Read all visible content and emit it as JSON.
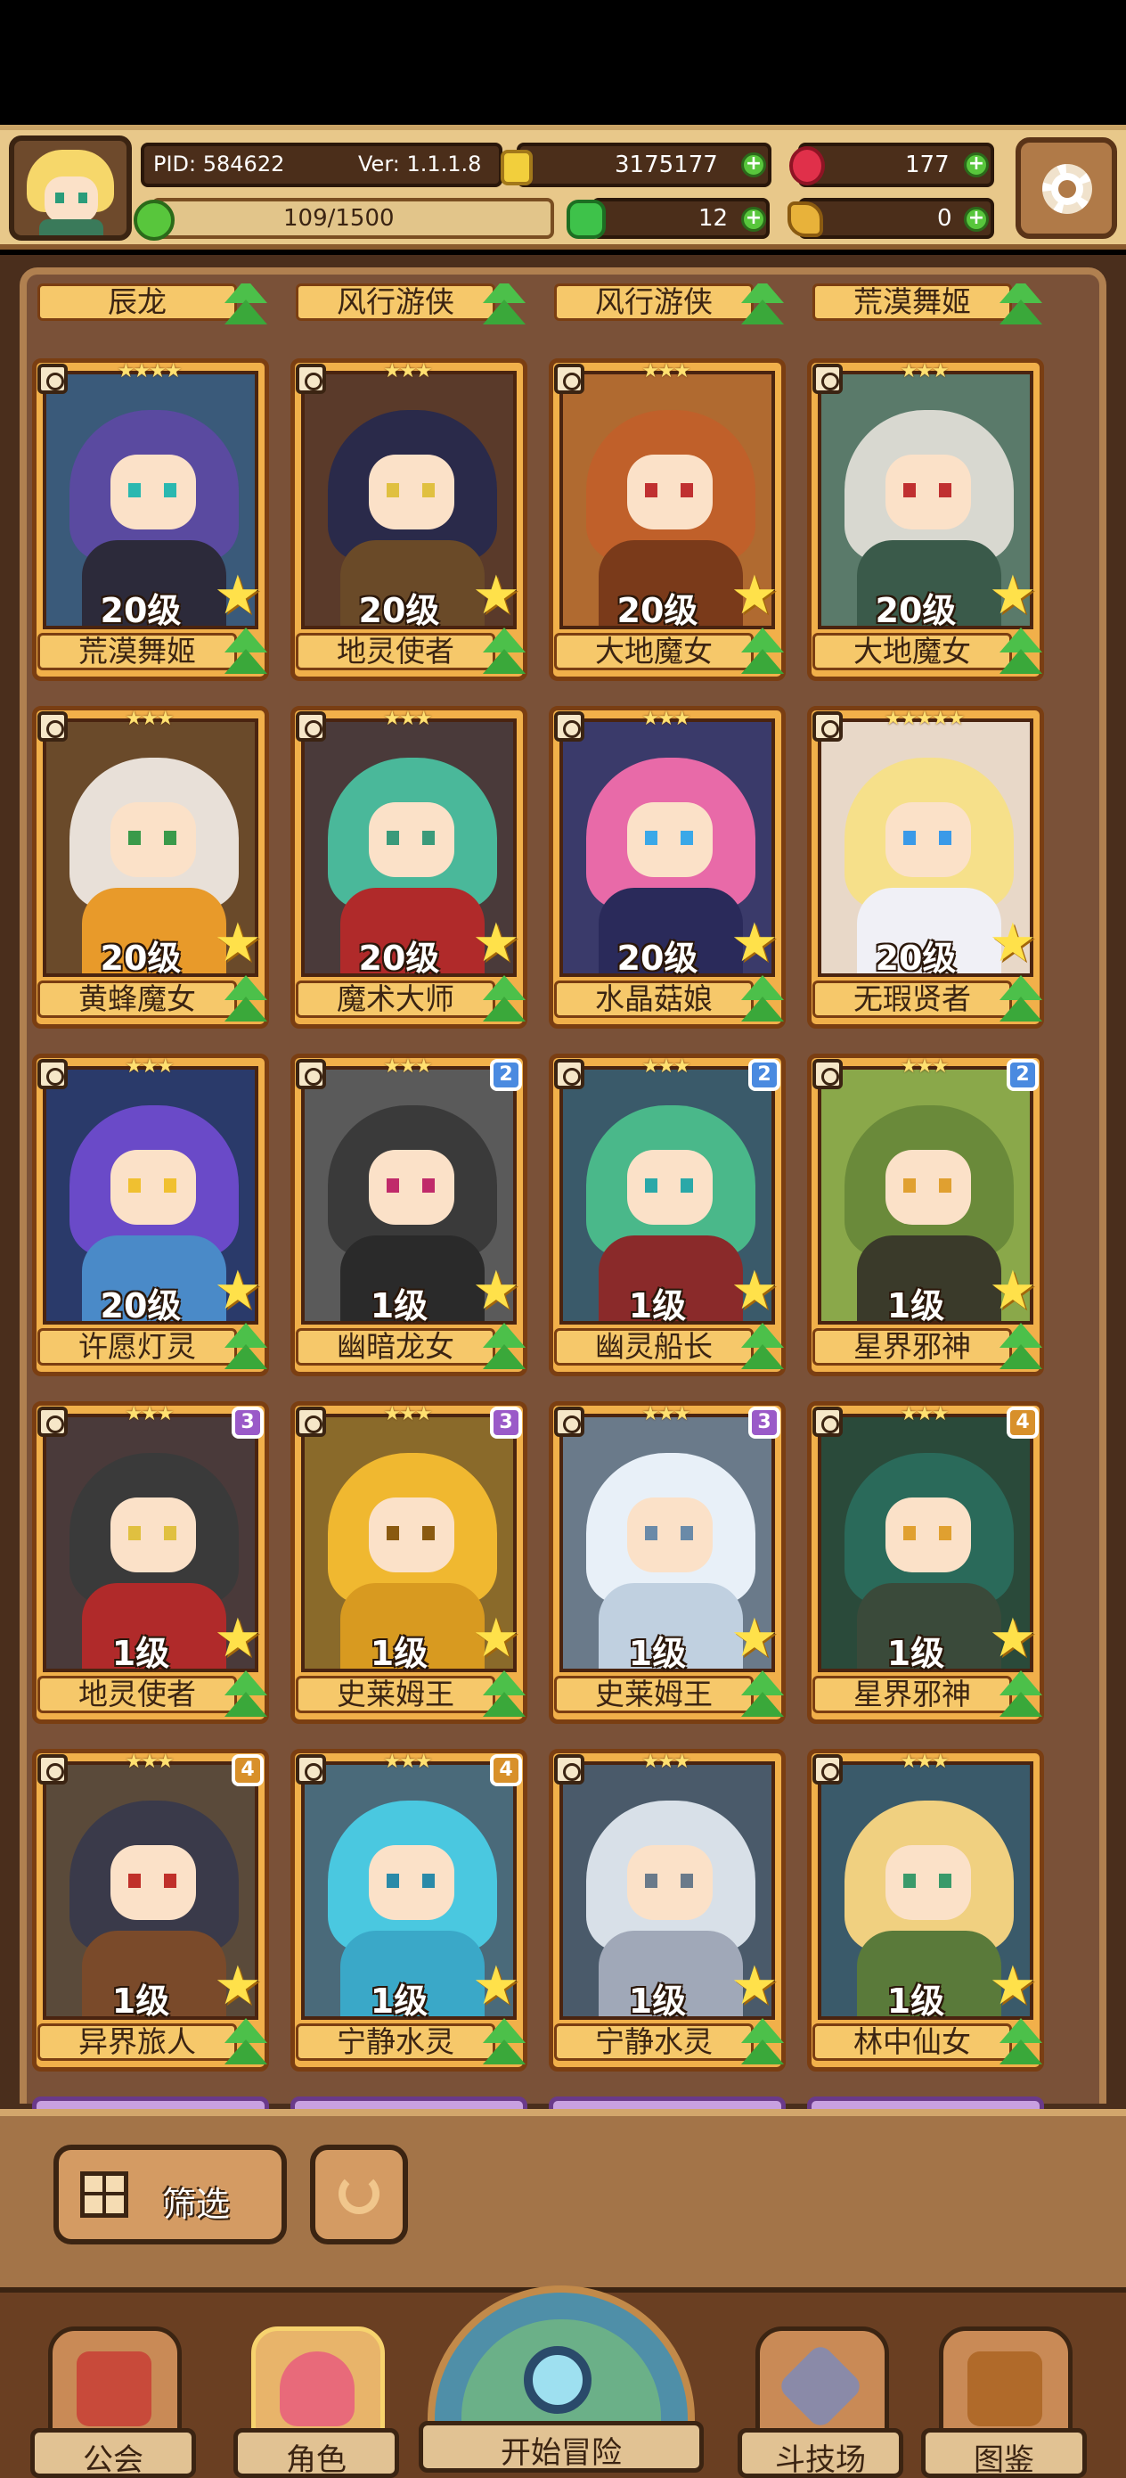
{
  "header": {
    "pid": "PID: 584622",
    "version": "Ver: 1.1.1.8",
    "gold": "3175177",
    "gems": "177",
    "exp": "109/1500",
    "clover": "12",
    "keys": "0"
  },
  "top_row_names": [
    "辰龙",
    "风行游侠",
    "风行游侠",
    "荒漠舞姬"
  ],
  "cards": [
    {
      "name": "荒漠舞姬",
      "level": "20级",
      "stars": "★★★★",
      "badge": "",
      "hair": "#5a4aa0",
      "body": "#2c2a3a",
      "bg": "#3a5a7a",
      "eye": "#2ab8b0"
    },
    {
      "name": "地灵使者",
      "level": "20级",
      "stars": "★★★",
      "badge": "",
      "hair": "#2a2a4a",
      "body": "#6a4a28",
      "bg": "#5a3a2a",
      "eye": "#e0c040"
    },
    {
      "name": "大地魔女",
      "level": "20级",
      "stars": "★★★",
      "badge": "",
      "hair": "#c0602a",
      "body": "#7a3a1a",
      "bg": "#b06a30",
      "eye": "#c03030"
    },
    {
      "name": "大地魔女",
      "level": "20级",
      "stars": "★★★",
      "badge": "",
      "hair": "#d8d8d0",
      "body": "#3a5a4a",
      "bg": "#5a7a6a",
      "eye": "#c03030"
    },
    {
      "name": "黄蜂魔女",
      "level": "20级",
      "stars": "★★★",
      "badge": "",
      "hair": "#e8e0d8",
      "body": "#e89a2a",
      "bg": "#6a4a2a",
      "eye": "#3a9a4a"
    },
    {
      "name": "魔术大师",
      "level": "20级",
      "stars": "★★★",
      "badge": "",
      "hair": "#4ab89a",
      "body": "#b02a2a",
      "bg": "#4a3a3a",
      "eye": "#3a9a7a"
    },
    {
      "name": "水晶菇娘",
      "level": "20级",
      "stars": "★★★",
      "badge": "",
      "hair": "#e86aa8",
      "body": "#2a2a5a",
      "bg": "#3a3a6a",
      "eye": "#3aa8e8"
    },
    {
      "name": "无瑕贤者",
      "level": "20级",
      "stars": "★★★★★",
      "badge": "",
      "hair": "#f6e08a",
      "body": "#f0f0f6",
      "bg": "#e8d8c8",
      "eye": "#3a9ae8"
    },
    {
      "name": "许愿灯灵",
      "level": "20级",
      "stars": "★★★",
      "badge": "",
      "hair": "#6a4ac8",
      "body": "#4a8ac8",
      "bg": "#2a3a6a",
      "eye": "#f0c030"
    },
    {
      "name": "幽暗龙女",
      "level": "1级",
      "stars": "★★★",
      "badge": "2",
      "hair": "#3a3a3a",
      "body": "#2a2a2a",
      "bg": "#5a5a5a",
      "eye": "#c02a6a"
    },
    {
      "name": "幽灵船长",
      "level": "1级",
      "stars": "★★★",
      "badge": "2",
      "hair": "#4ab88a",
      "body": "#8a2a2a",
      "bg": "#3a5a6a",
      "eye": "#2aa8a8"
    },
    {
      "name": "星界邪神",
      "level": "1级",
      "stars": "★★★",
      "badge": "2",
      "hair": "#6a8a3a",
      "body": "#3a3a2a",
      "bg": "#8aa84a",
      "eye": "#e0a030"
    },
    {
      "name": "地灵使者",
      "level": "1级",
      "stars": "★★★",
      "badge": "3",
      "hair": "#3a3a3a",
      "body": "#b02a2a",
      "bg": "#4a3a3a",
      "eye": "#e0c040"
    },
    {
      "name": "史莱姆王",
      "level": "1级",
      "stars": "★★★",
      "badge": "3",
      "hair": "#f0b830",
      "body": "#d89a20",
      "bg": "#8a6a2a",
      "eye": "#8a5a10"
    },
    {
      "name": "史莱姆王",
      "level": "1级",
      "stars": "★★★",
      "badge": "3",
      "hair": "#e8f0f8",
      "body": "#c0d0e0",
      "bg": "#6a7a8a",
      "eye": "#6a8aa8"
    },
    {
      "name": "星界邪神",
      "level": "1级",
      "stars": "★★★",
      "badge": "4",
      "hair": "#2a6a5a",
      "body": "#3a4a3a",
      "bg": "#2a4a3a",
      "eye": "#e0a030"
    },
    {
      "name": "异界旅人",
      "level": "1级",
      "stars": "★★★",
      "badge": "4",
      "hair": "#3a3a4a",
      "body": "#7a4a2a",
      "bg": "#5a4a3a",
      "eye": "#c0302a"
    },
    {
      "name": "宁静水灵",
      "level": "1级",
      "stars": "★★★",
      "badge": "4",
      "hair": "#4ac8e0",
      "body": "#3aa8c8",
      "bg": "#4a6a7a",
      "eye": "#2a8aa8"
    },
    {
      "name": "宁静水灵",
      "level": "1级",
      "stars": "★★★",
      "badge": "",
      "hair": "#d8e0e8",
      "body": "#a0a8b8",
      "bg": "#4a5a6a",
      "eye": "#6a7a8a"
    },
    {
      "name": "林中仙女",
      "level": "1级",
      "stars": "★★★",
      "badge": "",
      "hair": "#f0d080",
      "body": "#5a7a3a",
      "bg": "#3a5a6a",
      "eye": "#3a9a6a"
    }
  ],
  "badge_colors": {
    "2": "#4a8ae0",
    "3": "#9a5ac8",
    "4": "#d8902a"
  },
  "controls": {
    "filter_label": "筛选"
  },
  "nav": {
    "guild": "公会",
    "characters": "角色",
    "adventure": "开始冒险",
    "arena": "斗技场",
    "codex": "图鉴"
  }
}
